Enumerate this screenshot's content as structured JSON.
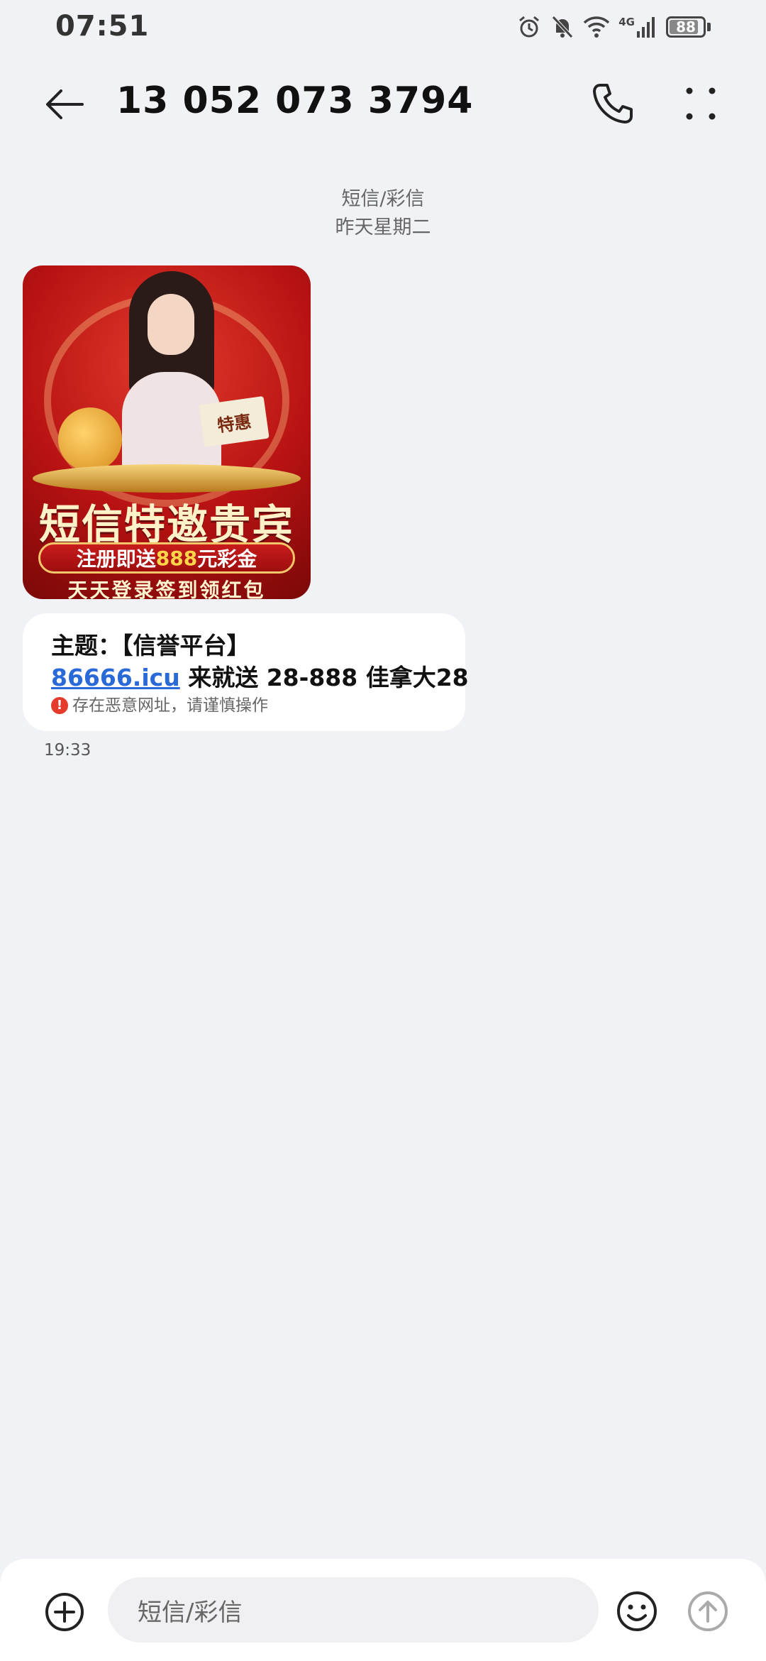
{
  "status_bar": {
    "time": "07:51",
    "battery": "88",
    "network": "4G",
    "battery_level": 0.88
  },
  "header": {
    "title": "13 052 073 3794"
  },
  "thread": {
    "message_type": "短信/彩信",
    "date_label": "昨天星期二"
  },
  "mms_image": {
    "sign_text": "特惠",
    "headline": "短信特邀贵宾",
    "ribbon_prefix": "注册即送",
    "ribbon_amount": "888",
    "ribbon_suffix": "元彩金",
    "footer": "天天登录签到领红包"
  },
  "message": {
    "subject": "主题：【信誉平台】",
    "link": "86666.icu",
    "body_rest": " 来就送 28-888 佳拿大28",
    "warning": "存在恶意网址，请谨慎操作",
    "time": "19:33"
  },
  "compose": {
    "placeholder": "短信/彩信"
  },
  "colors": {
    "background": "#f1f2f5",
    "link": "#2a6ad8",
    "warning": "#e53b2c"
  }
}
